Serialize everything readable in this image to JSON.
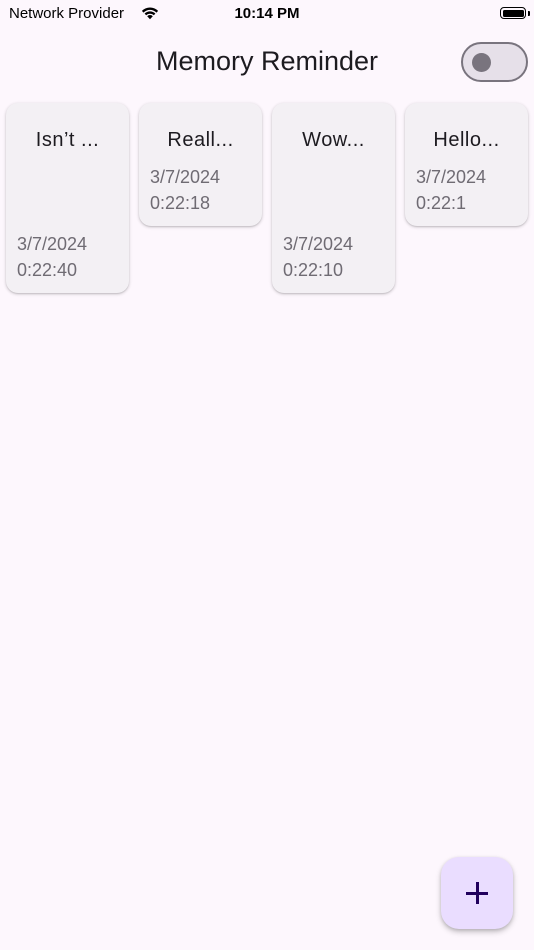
{
  "status_bar": {
    "carrier": "Network Provider",
    "time": "10:14 PM",
    "wifi_icon": "wifi-icon",
    "battery_icon": "battery-icon"
  },
  "app_bar": {
    "title": "Memory Reminder",
    "toggle_icon": "toggle-switch-icon",
    "toggle_on": false
  },
  "cards": [
    {
      "title": "Isn’t ...",
      "date": "3/7/2024",
      "time": "0:22:40"
    },
    {
      "title": "Reall...",
      "date": "3/7/2024",
      "time": "0:22:18"
    },
    {
      "title": "Wow...",
      "date": "3/7/2024",
      "time": "0:22:10"
    },
    {
      "title": "Hello...",
      "date": "3/7/2024",
      "time": "0:22:1"
    }
  ],
  "fab": {
    "icon": "plus-icon"
  },
  "colors": {
    "background": "#fdf7fd",
    "card": "#f3f0f4",
    "fab": "#eaddff",
    "fab_icon": "#21005d",
    "toggle_outline": "#79747e"
  }
}
